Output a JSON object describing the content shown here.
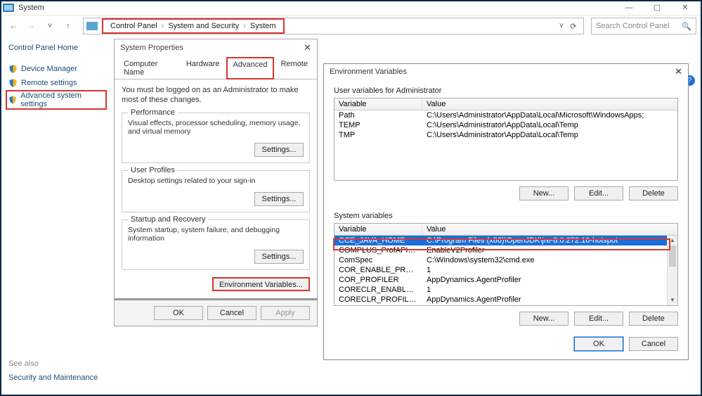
{
  "window": {
    "title": "System",
    "minimize": "—",
    "maximize": "▢",
    "close": "✕"
  },
  "nav": {
    "back": "←",
    "forward": "→",
    "up": "↑",
    "refresh": "⟳",
    "dropdown": "˅"
  },
  "breadcrumb": [
    "Control Panel",
    "System and Security",
    "System"
  ],
  "search": {
    "placeholder": "Search Control Panel"
  },
  "sidebar": {
    "home": "Control Panel Home",
    "items": [
      {
        "label": "Device Manager"
      },
      {
        "label": "Remote settings"
      },
      {
        "label": "Advanced system settings"
      }
    ]
  },
  "see_also": {
    "label": "See also",
    "link": "Security and Maintenance"
  },
  "sysprop": {
    "title": "System Properties",
    "note": "You must be logged on as an Administrator to make most of these changes.",
    "tabs": [
      "Computer Name",
      "Hardware",
      "Advanced",
      "Remote"
    ],
    "groups": {
      "perf": {
        "legend": "Performance",
        "desc": "Visual effects, processor scheduling, memory usage, and virtual memory",
        "btn": "Settings..."
      },
      "user": {
        "legend": "User Profiles",
        "desc": "Desktop settings related to your sign-in",
        "btn": "Settings..."
      },
      "startup": {
        "legend": "Startup and Recovery",
        "desc": "System startup, system failure, and debugging information",
        "btn": "Settings..."
      }
    },
    "envbtn": "Environment Variables...",
    "footer": {
      "ok": "OK",
      "cancel": "Cancel",
      "apply": "Apply"
    }
  },
  "envvar": {
    "title": "Environment Variables",
    "user_section": "User variables for Administrator",
    "col_var": "Variable",
    "col_val": "Value",
    "user_vars": [
      {
        "name": "Path",
        "value": "C:\\Users\\Administrator\\AppData\\Local\\Microsoft\\WindowsApps;"
      },
      {
        "name": "TEMP",
        "value": "C:\\Users\\Administrator\\AppData\\Local\\Temp"
      },
      {
        "name": "TMP",
        "value": "C:\\Users\\Administrator\\AppData\\Local\\Temp"
      }
    ],
    "sys_section": "System variables",
    "sys_vars": [
      {
        "name": "CCE_JAVA_HOME",
        "value": "C:\\Program Files (x86)\\OpenJDK\\jre-8.0.272.10-hotspot"
      },
      {
        "name": "COMPLUS_ProfAPI_ProfilerC...",
        "value": "EnableV2Profiler"
      },
      {
        "name": "ComSpec",
        "value": "C:\\Windows\\system32\\cmd.exe"
      },
      {
        "name": "COR_ENABLE_PROFILING",
        "value": "1"
      },
      {
        "name": "COR_PROFILER",
        "value": "AppDynamics.AgentProfiler"
      },
      {
        "name": "CORECLR_ENABLE_PROFILI...",
        "value": "1"
      },
      {
        "name": "CORECLR_PROFILER",
        "value": "AppDynamics.AgentProfiler"
      }
    ],
    "btns": {
      "new": "New...",
      "edit": "Edit...",
      "delete": "Delete",
      "ok": "OK",
      "cancel": "Cancel"
    }
  }
}
